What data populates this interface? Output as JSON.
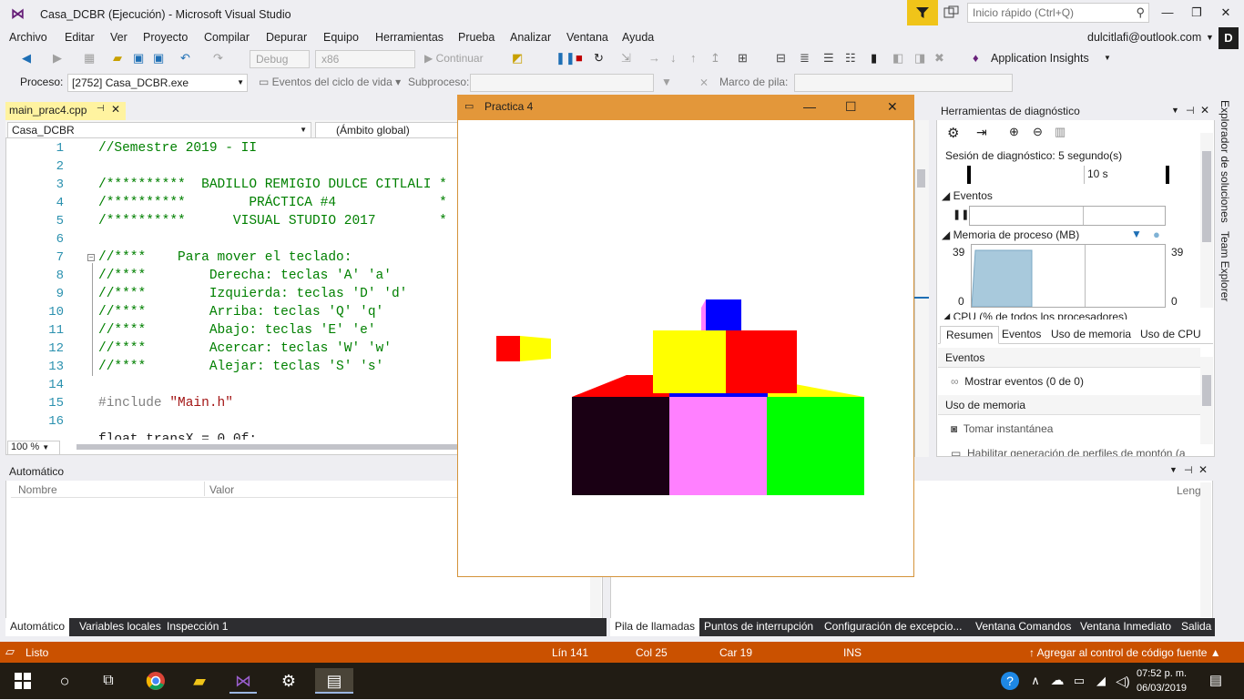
{
  "window": {
    "title": "Casa_DCBR (Ejecución) - Microsoft Visual Studio",
    "quick_launch_placeholder": "Inicio rápido (Ctrl+Q)",
    "account": "dulcitlafi@outlook.com",
    "avatar_initial": "D"
  },
  "menu": [
    "Archivo",
    "Editar",
    "Ver",
    "Proyecto",
    "Compilar",
    "Depurar",
    "Equipo",
    "Herramientas",
    "Prueba",
    "Analizar",
    "Ventana",
    "Ayuda"
  ],
  "toolbar": {
    "config": "Debug",
    "platform": "x86",
    "continue_label": "Continuar",
    "app_insights": "Application Insights"
  },
  "toolbar2": {
    "proceso_label": "Proceso:",
    "proceso_value": "[2752] Casa_DCBR.exe",
    "eventos_label": "Eventos del ciclo de vida",
    "subproceso_label": "Subproceso:",
    "marco_label": "Marco de pila:"
  },
  "editor": {
    "tab_label": "main_prac4.cpp",
    "project_combo": "Casa_DCBR",
    "scope_combo": "(Ámbito global)",
    "zoom": "100 %",
    "lines": [
      {
        "n": "1",
        "text": "//Semestre 2019 - II"
      },
      {
        "n": "2",
        "text": ""
      },
      {
        "n": "3",
        "text": "/**********  BADILLO REMIGIO DULCE CITLALI *"
      },
      {
        "n": "4",
        "text": "/**********        PRÁCTICA #4             *"
      },
      {
        "n": "5",
        "text": "/**********      VISUAL STUDIO 2017        *"
      },
      {
        "n": "6",
        "text": ""
      },
      {
        "n": "7",
        "text": "//****    Para mover el teclado:"
      },
      {
        "n": "8",
        "text": "//****        Derecha: teclas 'A' 'a'"
      },
      {
        "n": "9",
        "text": "//****        Izquierda: teclas 'D' 'd'"
      },
      {
        "n": "10",
        "text": "//****        Arriba: teclas 'Q' 'q'"
      },
      {
        "n": "11",
        "text": "//****        Abajo: teclas 'E' 'e'"
      },
      {
        "n": "12",
        "text": "//****        Acercar: teclas 'W' 'w'"
      },
      {
        "n": "13",
        "text": "//****        Alejar: teclas 'S' 's'"
      },
      {
        "n": "14",
        "text": ""
      },
      {
        "n": "15",
        "text": "#include "
      },
      {
        "n": "16",
        "text": ""
      }
    ],
    "include_file": "\"Main.h\"",
    "partial_line": "float transX = 0.0f;"
  },
  "gl_window": {
    "title": "Practica 4"
  },
  "diag": {
    "title": "Herramientas de diagnóstico",
    "session": "Sesión de diagnóstico: 5 segundo(s)",
    "timeline_mark": "10 s",
    "events_label": "Eventos",
    "memory_label": "Memoria de proceso (MB)",
    "mem_max_left": "39",
    "mem_min_left": "0",
    "mem_max_right": "39",
    "mem_min_right": "0",
    "cpu_label": "CPU (% de todos los procesadores)",
    "tabs": [
      "Resumen",
      "Eventos",
      "Uso de memoria",
      "Uso de CPU"
    ],
    "section_events": "Eventos",
    "show_events": "Mostrar eventos (0 de 0)",
    "section_memory": "Uso de memoria",
    "snapshot": "Tomar instantánea",
    "heap_profile": "Habilitar generación de perfiles de montón (a"
  },
  "side_tabs": [
    "Explorador de soluciones",
    "Team Explorer"
  ],
  "auto_panel": {
    "title": "Automático",
    "col_name": "Nombre",
    "col_value": "Valor",
    "col_lang": "Leng"
  },
  "bottom_tabs_left": [
    "Automático",
    "Variables locales",
    "Inspección 1"
  ],
  "bottom_tabs_right": [
    "Pila de llamadas",
    "Puntos de interrupción",
    "Configuración de excepcio...",
    "Ventana Comandos",
    "Ventana Inmediato",
    "Salida"
  ],
  "status": {
    "ready": "Listo",
    "line": "Lín 141",
    "col": "Col 25",
    "car": "Car 19",
    "ins": "INS",
    "source_control": "Agregar al control de código fuente"
  },
  "clock": {
    "time": "07:52 p. m.",
    "date": "06/03/2019"
  },
  "colors": {
    "accent": "#ca5100",
    "gl_title": "#e3973a"
  }
}
